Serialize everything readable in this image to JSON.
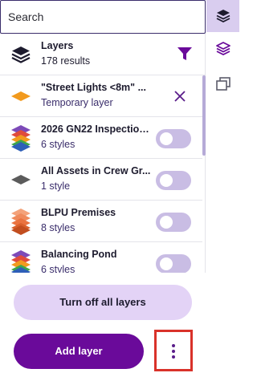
{
  "search": {
    "placeholder": "Search"
  },
  "header": {
    "title": "Layers",
    "count": "178 results",
    "icon": "layers-stack-icon",
    "filter_icon": "filter-funnel-icon"
  },
  "layers": [
    {
      "title": "\"Street Lights <8m\" ...",
      "subtitle": "Temporary layer",
      "icon": "diamond-orange-icon",
      "control": "close",
      "on": false
    },
    {
      "title": "2026 GN22 Inspection ...",
      "subtitle": "6 styles",
      "icon": "stacked-layers-multicolor-icon",
      "control": "toggle",
      "on": false
    },
    {
      "title": "All Assets in Crew Gr...",
      "subtitle": "1 style",
      "icon": "diamond-grey-icon",
      "control": "toggle",
      "on": false
    },
    {
      "title": "BLPU Premises",
      "subtitle": "8 styles",
      "icon": "stacked-layers-orange-icon",
      "control": "toggle",
      "on": false
    },
    {
      "title": "Balancing Pond",
      "subtitle": "6 styles",
      "icon": "stacked-layers-multicolor-icon",
      "control": "toggle",
      "on": false
    }
  ],
  "footer": {
    "turn_off_label": "Turn off all layers",
    "add_layer_label": "Add layer",
    "more_icon": "more-vertical-icon"
  },
  "rail": {
    "items": [
      {
        "icon": "layers-icon",
        "active": true
      },
      {
        "icon": "layers-outline-icon",
        "active": false
      },
      {
        "icon": "copy-windows-icon",
        "active": false
      }
    ]
  },
  "colors": {
    "accent": "#6a0a9a",
    "accent_light": "#e3d3f6",
    "toggle_off": "#c9bde4",
    "highlight_border": "#d9322a",
    "text_secondary": "#3a2d6b"
  }
}
